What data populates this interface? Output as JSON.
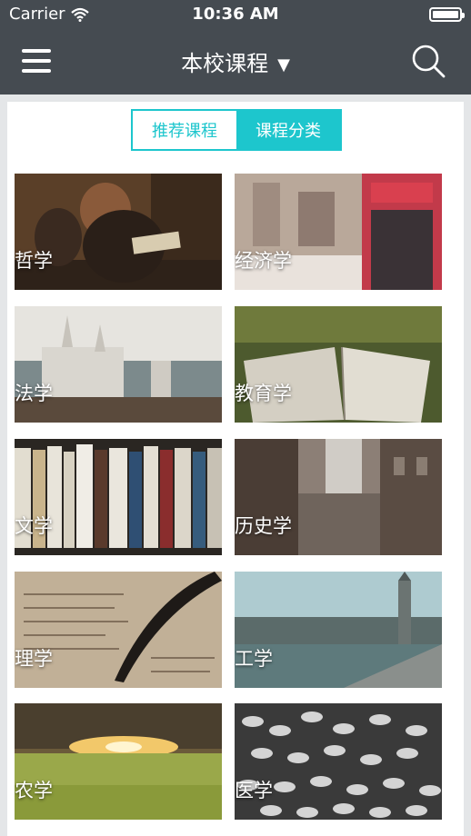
{
  "status_bar": {
    "carrier": "Carrier",
    "time": "10:36 AM"
  },
  "nav": {
    "title": "本校课程"
  },
  "tabs": [
    {
      "label": "推荐课程",
      "selected": false
    },
    {
      "label": "课程分类",
      "selected": true
    }
  ],
  "categories": [
    {
      "label": "哲学",
      "image": "painting of two bearded philosophers at a desk"
    },
    {
      "label": "经济学",
      "image": "street café with Coca-Cola sign board"
    },
    {
      "label": "法学",
      "image": "Neuschwanstein castle"
    },
    {
      "label": "教育学",
      "image": "open book lying on grass"
    },
    {
      "label": "文学",
      "image": "row of books on a shelf"
    },
    {
      "label": "历史学",
      "image": "old European street in rain"
    },
    {
      "label": "理学",
      "image": "quill pen on handwritten manuscript"
    },
    {
      "label": "工学",
      "image": "Big Ben and Houses of Parliament"
    },
    {
      "label": "农学",
      "image": "wheat field at sunset"
    },
    {
      "label": "医学",
      "image": "pile of white pills"
    }
  ],
  "colors": {
    "header": "#454b51",
    "accent": "#1dc6cd"
  }
}
